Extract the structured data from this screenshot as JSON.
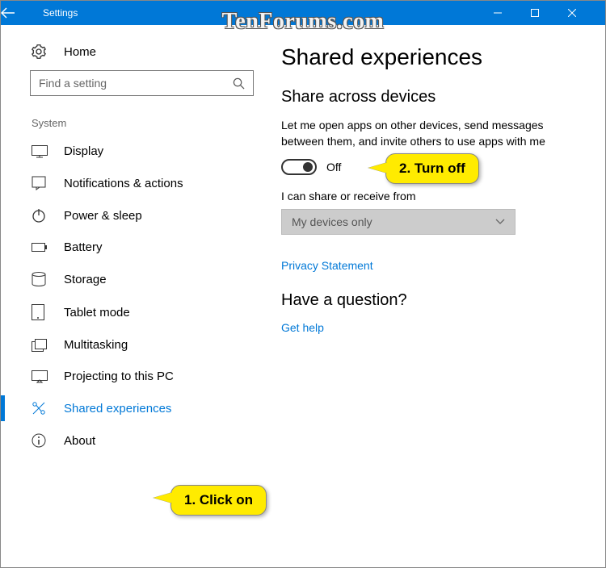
{
  "watermark": "TenForums.com",
  "titlebar": {
    "title": "Settings"
  },
  "sidebar": {
    "home": "Home",
    "search_placeholder": "Find a setting",
    "category": "System",
    "items": [
      {
        "label": "Display"
      },
      {
        "label": "Notifications & actions"
      },
      {
        "label": "Power & sleep"
      },
      {
        "label": "Battery"
      },
      {
        "label": "Storage"
      },
      {
        "label": "Tablet mode"
      },
      {
        "label": "Multitasking"
      },
      {
        "label": "Projecting to this PC"
      },
      {
        "label": "Shared experiences"
      },
      {
        "label": "About"
      }
    ]
  },
  "main": {
    "heading": "Shared experiences",
    "section1_title": "Share across devices",
    "section1_desc": "Let me open apps on other devices, send messages between them, and invite others to use apps with me",
    "toggle_label": "Off",
    "share_from_label": "I can share or receive from",
    "dropdown_value": "My devices only",
    "privacy_link": "Privacy Statement",
    "question_heading": "Have a question?",
    "help_link": "Get help"
  },
  "callouts": {
    "c1": "1. Click on",
    "c2": "2. Turn off"
  }
}
